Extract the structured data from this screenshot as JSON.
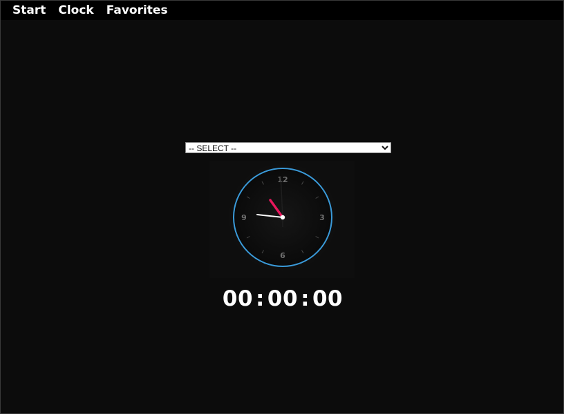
{
  "nav": {
    "items": [
      {
        "label": "Start"
      },
      {
        "label": "Clock"
      },
      {
        "label": "Favorites"
      }
    ]
  },
  "timezone_select": {
    "selected": "-- SELECT --",
    "options": [
      "-- SELECT --"
    ]
  },
  "analog_clock": {
    "numerals": {
      "top": "12",
      "right": "3",
      "bottom": "6",
      "left": "9"
    },
    "hour_hand_color": "#e8175d",
    "ring_color": "#3a9ad9",
    "time_shown": "10:47"
  },
  "digital_clock": {
    "hours": "00",
    "minutes": "00",
    "seconds": "00",
    "separator": ":"
  },
  "colors": {
    "background": "#0c0c0c",
    "nav_background": "#000000",
    "text": "#ffffff"
  }
}
